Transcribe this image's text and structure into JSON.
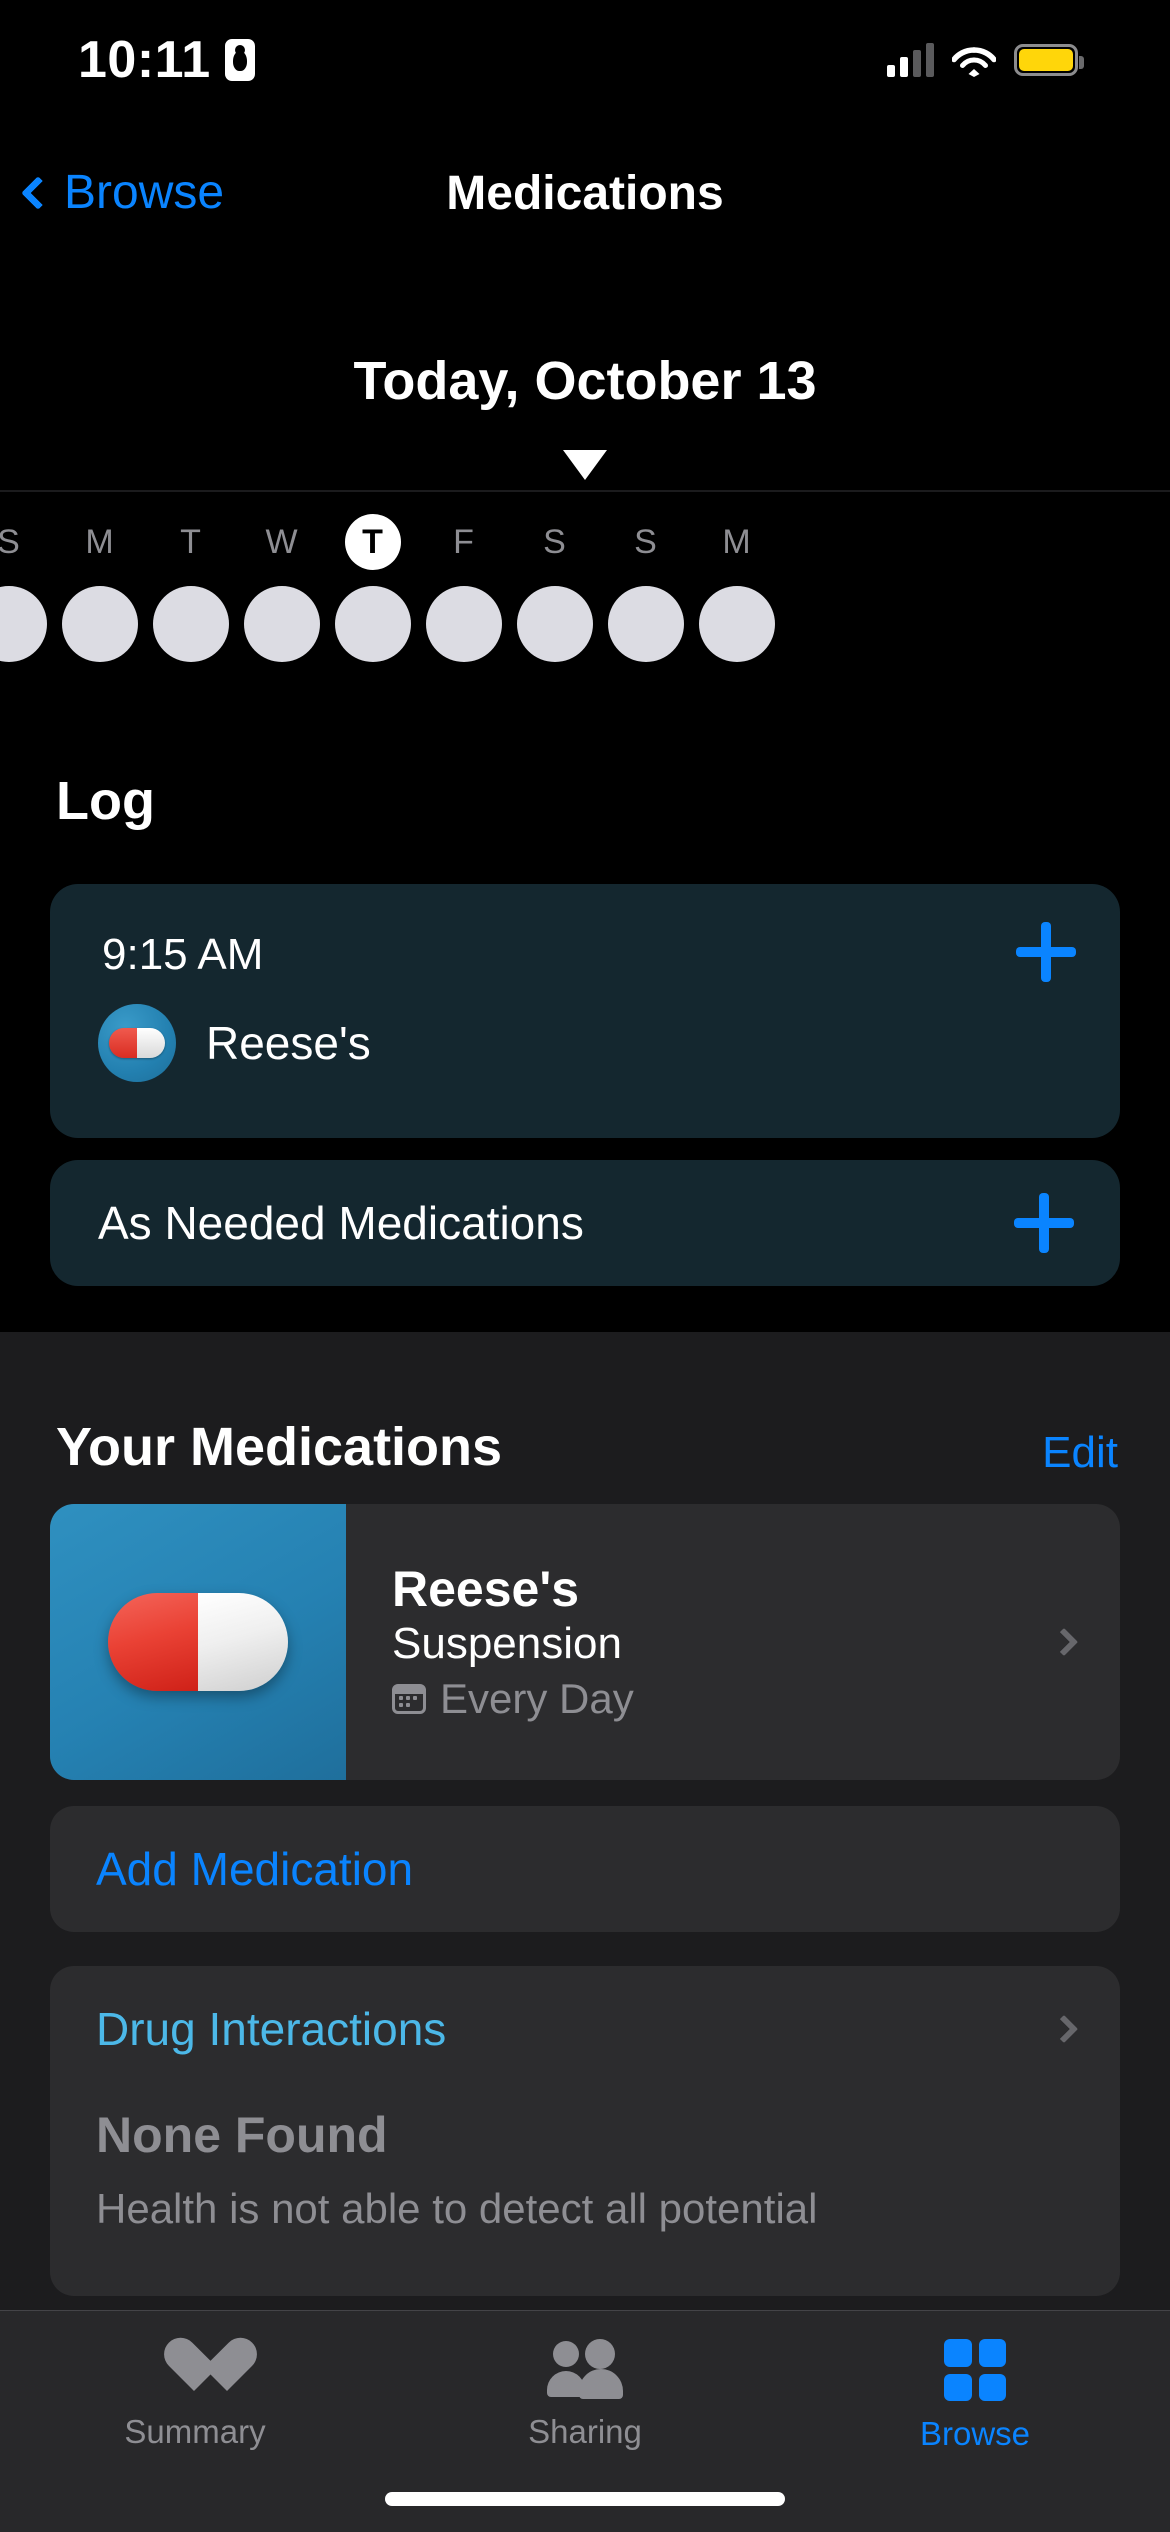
{
  "status_bar": {
    "time": "10:11",
    "icons": [
      "screen-recording-icon",
      "cellular-signal-icon",
      "wifi-icon",
      "battery-icon"
    ],
    "battery_color": "#ffd60a"
  },
  "nav": {
    "back_label": "Browse",
    "title": "Medications"
  },
  "date_header": {
    "title": "Today, October 13"
  },
  "day_strip": {
    "days": [
      {
        "letter": "S",
        "selected": false
      },
      {
        "letter": "M",
        "selected": false
      },
      {
        "letter": "T",
        "selected": false
      },
      {
        "letter": "W",
        "selected": false
      },
      {
        "letter": "T",
        "selected": true
      },
      {
        "letter": "F",
        "selected": false
      },
      {
        "letter": "S",
        "selected": false
      },
      {
        "letter": "S",
        "selected": false
      },
      {
        "letter": "M",
        "selected": false
      }
    ]
  },
  "log": {
    "title": "Log",
    "entry": {
      "time": "9:15 AM",
      "medication": "Reese's",
      "add_icon": "plus-icon"
    },
    "as_needed": {
      "label": "As Needed Medications",
      "add_icon": "plus-icon"
    }
  },
  "your_medications": {
    "title": "Your Medications",
    "edit_label": "Edit",
    "items": [
      {
        "name": "Reese's",
        "form": "Suspension",
        "schedule": "Every Day",
        "schedule_icon": "calendar-icon"
      }
    ],
    "add_medication_label": "Add Medication"
  },
  "drug_interactions": {
    "title": "Drug Interactions",
    "status": "None Found",
    "description": "Health is not able to detect all potential"
  },
  "tab_bar": {
    "tabs": [
      {
        "label": "Summary",
        "icon": "heart-icon",
        "active": false
      },
      {
        "label": "Sharing",
        "icon": "people-icon",
        "active": false
      },
      {
        "label": "Browse",
        "icon": "grid-icon",
        "active": true
      }
    ]
  },
  "colors": {
    "accent_blue": "#0a84ff",
    "interaction_blue": "#4cb8e8",
    "log_card": "#14272f",
    "section_bg": "#1c1c1e",
    "card_bg": "#2c2c2e"
  }
}
